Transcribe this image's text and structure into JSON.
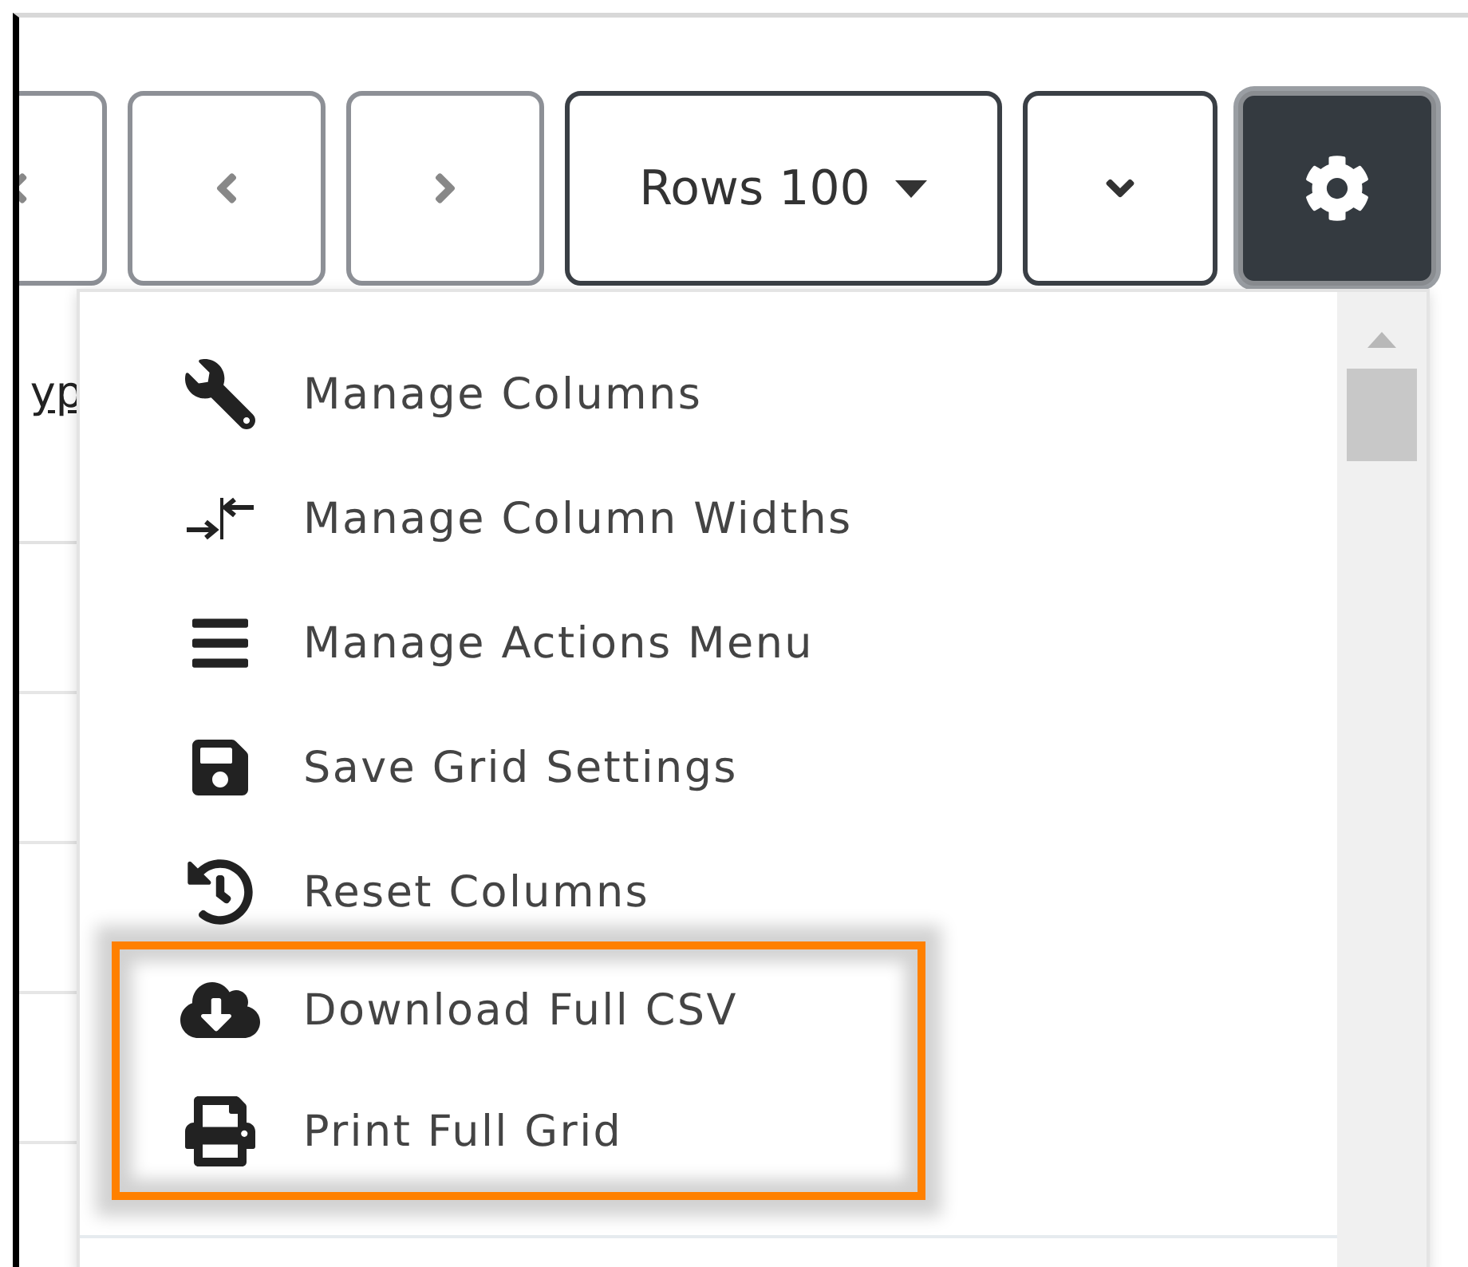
{
  "toolbar": {
    "buttons": [
      {
        "kind": "first"
      },
      {
        "kind": "previous"
      },
      {
        "kind": "next"
      },
      {
        "kind": "rows",
        "label": "Rows 100"
      },
      {
        "kind": "expand"
      },
      {
        "kind": "settings",
        "active": true
      }
    ]
  },
  "grid": {
    "header": "yp"
  },
  "menu": {
    "items": [
      {
        "kind": "wrench",
        "label": "Manage Columns",
        "highlighted": false
      },
      {
        "kind": "widths",
        "label": "Manage Column Widths",
        "highlighted": false
      },
      {
        "kind": "lines",
        "label": "Manage Actions Menu",
        "highlighted": false
      },
      {
        "kind": "save",
        "label": "Save Grid Settings",
        "highlighted": false
      },
      {
        "kind": "reset",
        "label": "Reset Columns",
        "highlighted": false
      },
      {
        "kind": "download",
        "label": "Download Full CSV",
        "highlighted": true
      },
      {
        "kind": "print",
        "label": "Print Full Grid",
        "highlighted": true
      }
    ]
  }
}
